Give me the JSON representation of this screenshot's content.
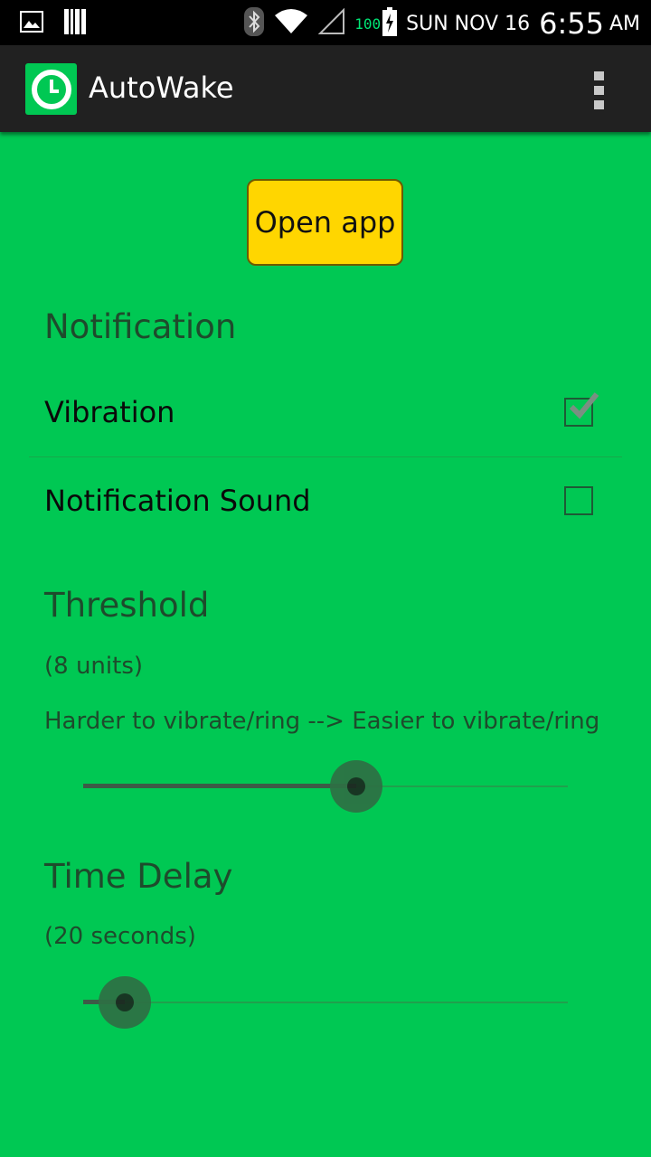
{
  "status_bar": {
    "date": "SUN NOV 16",
    "time": "6:55",
    "ampm": "AM",
    "battery_percent": "100",
    "icons": [
      "image-icon",
      "barcode-icon",
      "bluetooth-icon",
      "wifi-icon",
      "signal-icon",
      "battery-charging-icon"
    ]
  },
  "action_bar": {
    "title": "AutoWake",
    "logo_icon": "clock-icon",
    "menu_icon": "overflow-menu-icon"
  },
  "open_app_button": {
    "label": "Open app"
  },
  "notification": {
    "header": "Notification",
    "vibration": {
      "title": "Vibration",
      "checked": true
    },
    "sound": {
      "title": "Notification Sound",
      "checked": false
    }
  },
  "threshold": {
    "header": "Threshold",
    "value_text": "(8 units)",
    "hint": "Harder to vibrate/ring --> Easier to vibrate/ring",
    "level_fraction": 0.564
  },
  "time_delay": {
    "header": "Time Delay",
    "value_text": "(20 seconds)",
    "level_fraction": 0.086
  },
  "colors": {
    "background": "#00c853",
    "action_bar": "#212121",
    "button": "#ffd600",
    "header_text": "#1e4b2c"
  }
}
